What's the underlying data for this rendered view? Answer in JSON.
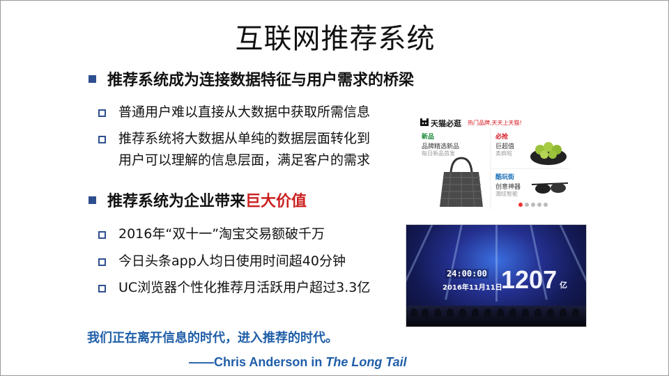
{
  "title": "互联网推荐系统",
  "heading1": "推荐系统成为连接数据特征与用户需求的桥梁",
  "sub1": [
    "普通用户难以直接从大数据中获取所需信息",
    "推荐系统将大数据从单纯的数据层面转化到",
    "用户可以理解的信息层面，满足客户的需求"
  ],
  "heading2": {
    "prefix": "推荐系统为企业带来",
    "highlight": "巨大价值",
    "highlight_color": "#cc1f1f"
  },
  "sub2": [
    "2016年“双十一”淘宝交易额破千万",
    "今日头条app人均日使用时间超40分钟",
    "UC浏览器个性化推荐月活跃用户超过3.3亿"
  ],
  "quote": "我们正在离开信息的时代，进入推荐的时代。",
  "attribution": {
    "prefix": "——Chris Anderson in ",
    "work": "The Long Tail"
  },
  "tmall": {
    "logo": "天猫必逛",
    "slogan": "热门品牌,天天上天猫!",
    "col1": {
      "heading": "新品",
      "line1": "品牌精选新品",
      "line2": "每日新品首发"
    },
    "col2": {
      "heading": "必抢",
      "line1": "巨超值",
      "line2": "卖疯啦"
    },
    "col3": {
      "heading": "酷玩街",
      "line1": "创意神器",
      "line2": "潮炫智能"
    }
  },
  "double11": {
    "clock": "24:00:00",
    "date": "2016年11月11日",
    "amount": "1207",
    "unit": "亿"
  },
  "colors": {
    "accent_blue": "#2e4f8f",
    "quote_blue": "#1f5ea8",
    "tmall_red": "#d6141d"
  }
}
